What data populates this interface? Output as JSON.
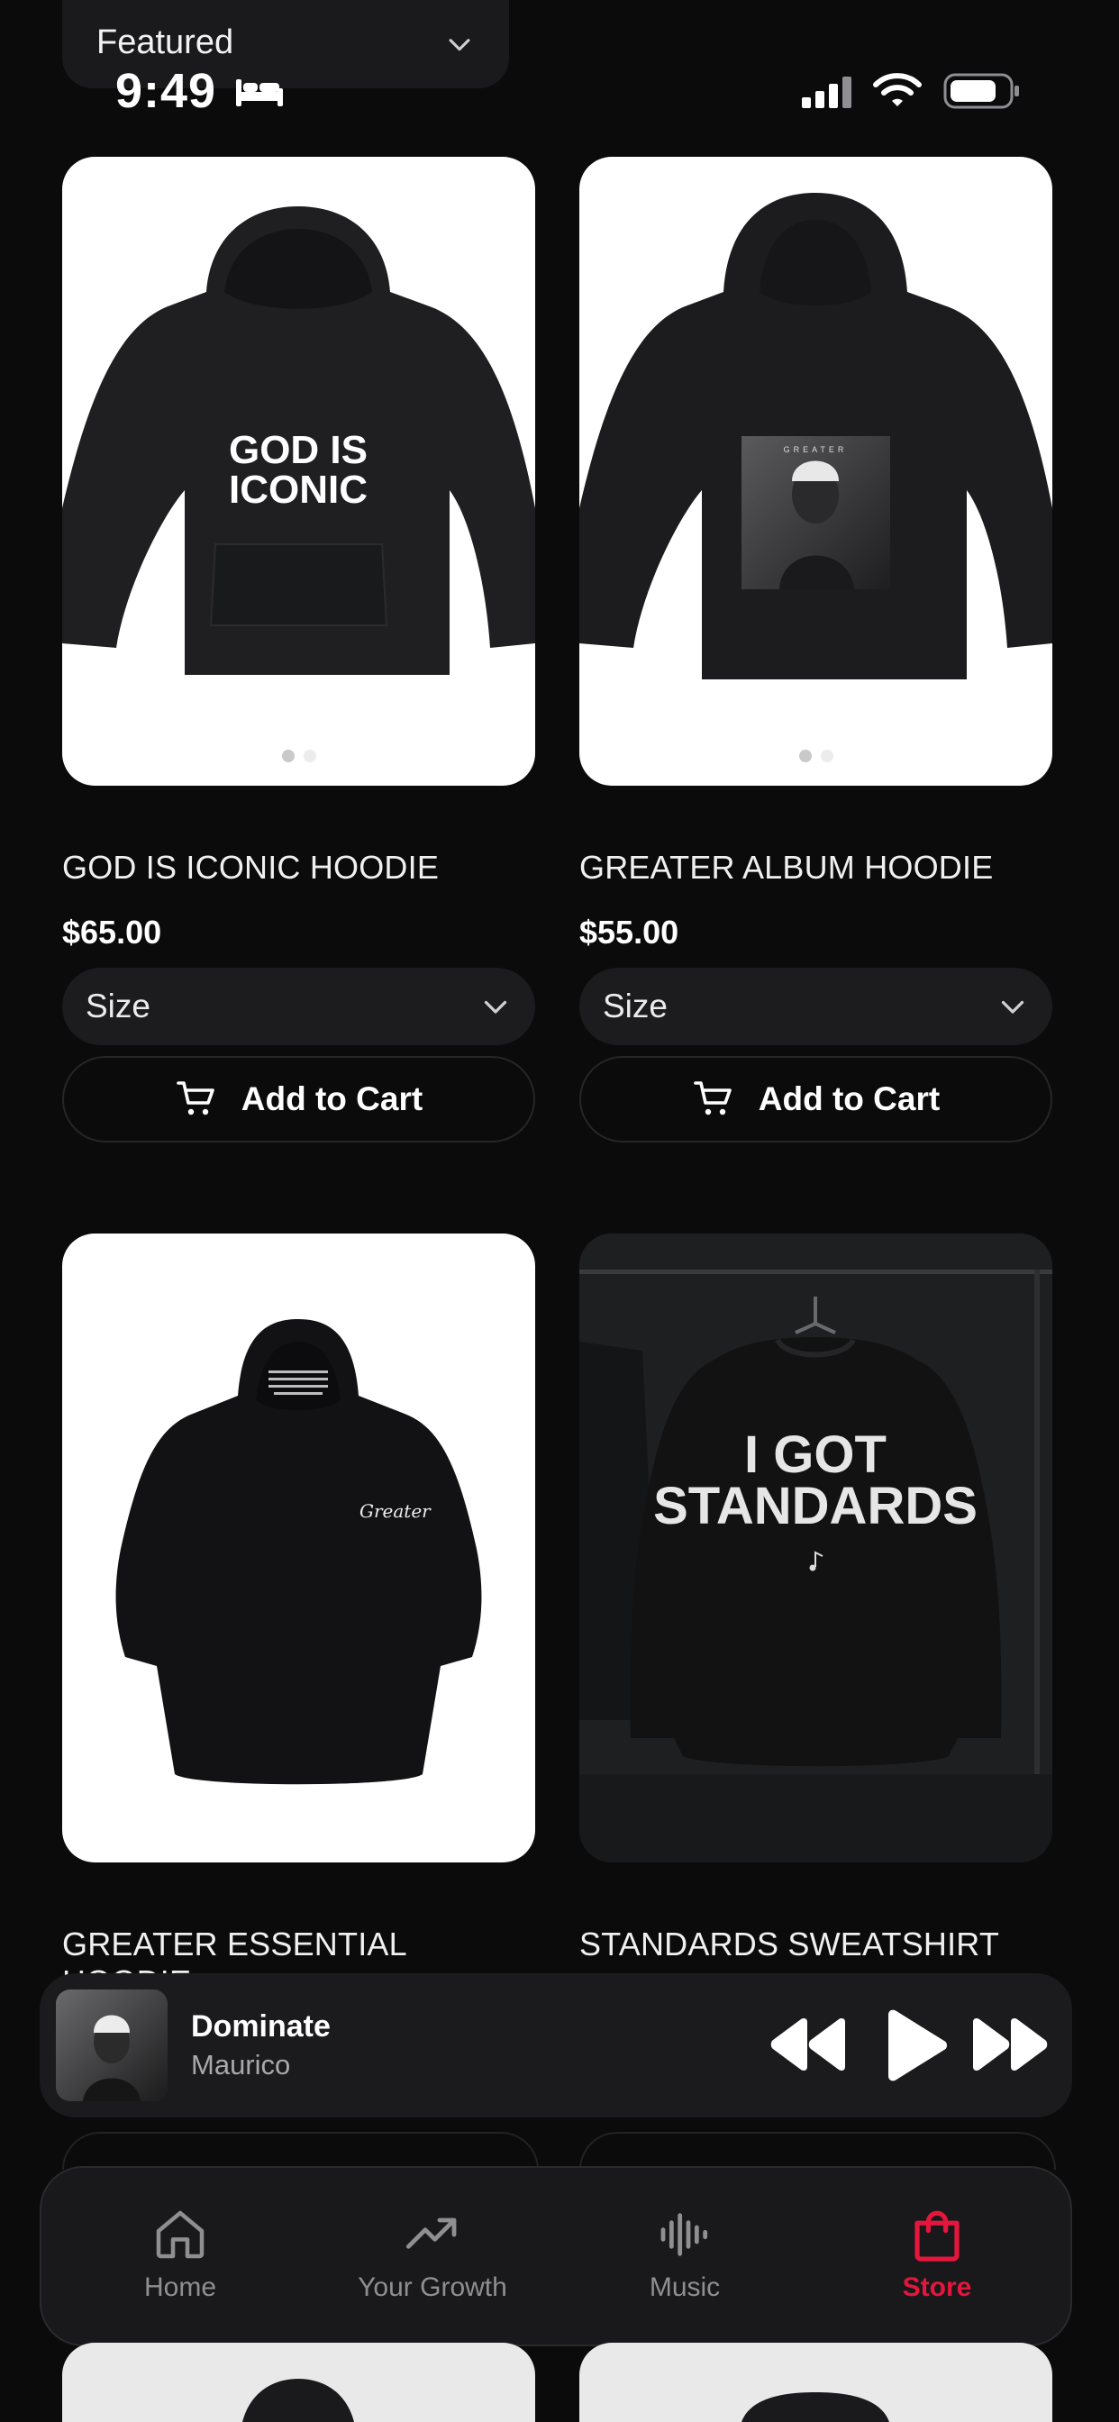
{
  "status_bar": {
    "time": "9:49"
  },
  "header": {
    "sort_label": "Featured"
  },
  "products": [
    {
      "title": "GOD IS ICONIC HOODIE",
      "price": "$65.00",
      "size_label": "Size",
      "cart_label": "Add to Cart",
      "print_text": [
        "GOD IS",
        "ICONIC"
      ]
    },
    {
      "title": "GREATER ALBUM HOODIE",
      "price": "$55.00",
      "size_label": "Size",
      "cart_label": "Add to Cart",
      "print_text": [
        "GREATER"
      ]
    },
    {
      "title": "GREATER ESSENTIAL HOODIE",
      "print_text": [
        "Greater"
      ]
    },
    {
      "title": "STANDARDS SWEATSHIRT",
      "print_text": [
        "I GOT",
        "STANDARDS"
      ]
    }
  ],
  "now_playing": {
    "title": "Dominate",
    "artist": "Maurico"
  },
  "tabs": [
    {
      "label": "Home",
      "icon": "home-icon"
    },
    {
      "label": "Your Growth",
      "icon": "trending-up-icon"
    },
    {
      "label": "Music",
      "icon": "waveform-icon"
    },
    {
      "label": "Store",
      "icon": "shopping-bag-icon",
      "active": true
    }
  ],
  "colors": {
    "accent": "#e5163b",
    "background": "#0b0b0c",
    "card": "#1c1c1e"
  }
}
